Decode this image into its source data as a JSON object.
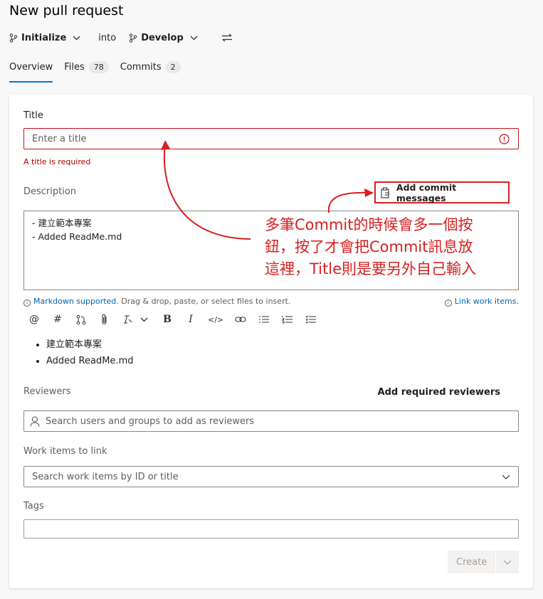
{
  "page": {
    "title": "New pull request"
  },
  "branches": {
    "source": "Initialize",
    "into_label": "into",
    "target": "Develop"
  },
  "tabs": [
    {
      "label": "Overview"
    },
    {
      "label": "Files",
      "count": "78"
    },
    {
      "label": "Commits",
      "count": "2"
    }
  ],
  "form": {
    "title_label": "Title",
    "title_placeholder": "Enter a title",
    "title_error": "A title is required",
    "description_label": "Description",
    "add_commit_messages_label": "Add commit messages",
    "description_lines": [
      "- 建立範本專案",
      "- Added ReadMe.md"
    ],
    "markdown_link": "Markdown supported.",
    "markdown_hint": " Drag & drop, paste, or select files to insert.",
    "link_work_items": "Link work items.",
    "preview_items": [
      "建立範本專案",
      "Added ReadMe.md"
    ],
    "reviewers_label": "Reviewers",
    "add_required_reviewers": "Add required reviewers",
    "reviewers_placeholder": "Search users and groups to add as reviewers",
    "work_items_label": "Work items to link",
    "work_items_placeholder": "Search work items by ID or title",
    "tags_label": "Tags",
    "create_label": "Create"
  },
  "annotation": {
    "text_lines": [
      "多筆Commit的時候會多一個按",
      "鈕，按了才會把Commit訊息放",
      "這裡，Title則是要另外自己輸入"
    ]
  },
  "toolbar_icons": [
    "mention-icon",
    "hashtag-icon",
    "pull-request-icon",
    "attach-icon",
    "highlight-icon",
    "bold-icon",
    "italic-icon",
    "code-icon",
    "link-icon",
    "bulleted-list-icon",
    "numbered-list-icon",
    "checklist-icon"
  ],
  "colors": {
    "accent": "#0078d4",
    "error": "#c50f1f",
    "annotation": "#d62020"
  }
}
